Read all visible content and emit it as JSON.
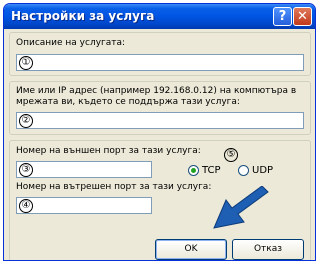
{
  "window": {
    "title": "Настройки за услуга",
    "help_glyph": "?",
    "close_glyph": "✕"
  },
  "fields": {
    "description": {
      "label": "Описание на услугата:",
      "value": "①"
    },
    "ip": {
      "label": "Име или IP адрес (например 192.168.0.12) на компютъра в мрежата ви, където се поддържа тази услуга:",
      "value": "②"
    },
    "external_port": {
      "label": "Номер на външен порт за тази услуга:",
      "value": "③"
    },
    "internal_port": {
      "label": "Номер на вътрешен порт за тази услуга:",
      "value": "④"
    }
  },
  "protocol": {
    "marker": "⑤",
    "tcp_label": "TCP",
    "udp_label": "UDP",
    "selected": "TCP"
  },
  "buttons": {
    "ok": "OK",
    "cancel": "Отказ"
  },
  "colors": {
    "title_bar": "#0054e3",
    "arrow": "#1e5fb4",
    "close": "#c2391b"
  },
  "icons": [
    "help-icon",
    "close-icon",
    "pointer-arrow-icon"
  ]
}
